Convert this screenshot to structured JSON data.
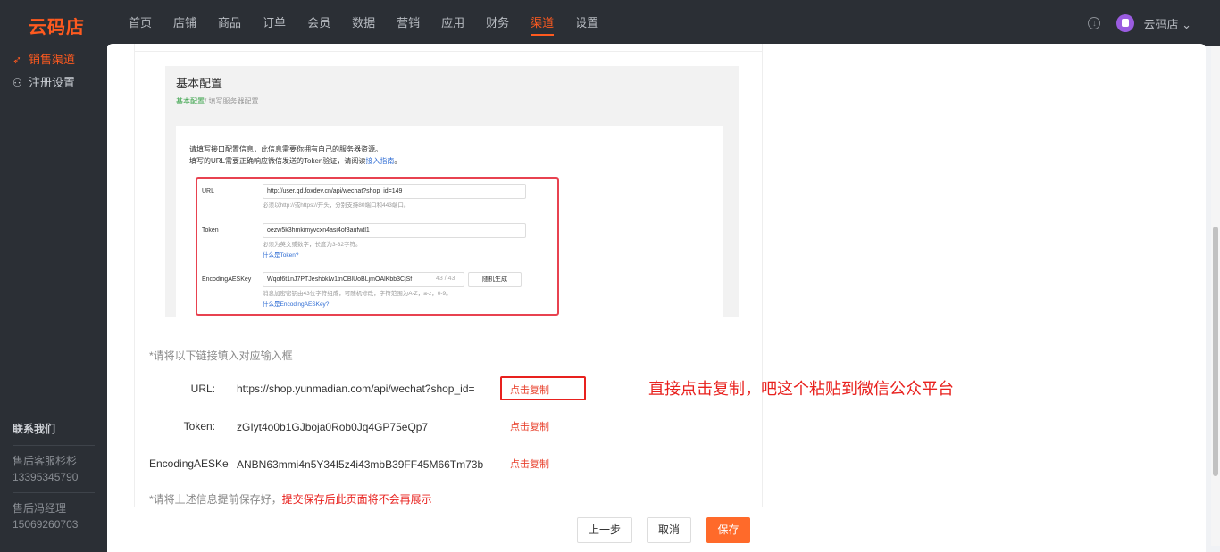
{
  "brand": {
    "logo": "云码店",
    "accent": "#ff5a1f"
  },
  "nav": {
    "items": [
      "首页",
      "店铺",
      "商品",
      "订单",
      "会员",
      "数据",
      "营销",
      "应用",
      "财务",
      "渠道",
      "设置"
    ],
    "active": "渠道"
  },
  "topright": {
    "store_name": "云码店 ⌄",
    "download_icon": "download-icon"
  },
  "sidebar": {
    "items": [
      {
        "label": "销售渠道",
        "icon": "send-icon",
        "active": true
      },
      {
        "label": "注册设置",
        "icon": "user-settings-icon",
        "active": false
      }
    ],
    "contact_title": "联系我们",
    "contacts": [
      {
        "name": "售后客服杉杉",
        "phone": "13395345790"
      },
      {
        "name": "售后冯经理",
        "phone": "15069260703"
      }
    ]
  },
  "screenshot": {
    "title": "基本配置",
    "crumb_active": "基本配置",
    "crumb_rest": "/ 填写服务器配置",
    "desc_line1": "请填写接口配置信息，此信息需要你拥有自己的服务器资源。",
    "desc_line2": "填写的URL需要正确响应微信发送的Token验证，请阅读",
    "desc_link": "接入指南",
    "desc_end": "。",
    "url_label": "URL",
    "url_value": "http://user.qd.foxdev.cn/api/wechat?shop_id=149",
    "url_hint": "必须以http://或https://开头，分别支持80端口和443端口。",
    "token_label": "Token",
    "token_value": "oezw5k3hmkimyvcxn4asi4of3aufwtl1",
    "token_hint": "必须为英文或数字，长度为3-32字符。",
    "token_link": "什么是Token?",
    "aes_label": "EncodingAESKey",
    "aes_value": "Wqof6t1nJ7PTJeshbklw1tnCBlUoBLjmOAlKbb3CjSf",
    "aes_count": "43 / 43",
    "aes_button": "随机生成",
    "aes_hint": "消息加密密钥由43位字符组成，可随机修改，字符范围为A-Z，a-z，0-9。",
    "aes_link": "什么是EncodingAESKey?"
  },
  "instructions": {
    "fill_note": "*请将以下链接填入对应输入框"
  },
  "fields": {
    "url": {
      "label": "URL:",
      "value": "https://shop.yunmadian.com/api/wechat?shop_id=",
      "copy": "点击复制"
    },
    "token": {
      "label": "Token:",
      "value": "zGIyt4o0b1GJboja0Rob0Jq4GP75eQp7",
      "copy": "点击复制"
    },
    "aes": {
      "label": "EncodingAESKe",
      "value": "ANBN63mmi4n5Y34I5z4i43mbB39FF45M66Tm73b",
      "copy": "点击复制"
    }
  },
  "save_note": {
    "prefix": "*请将上述信息提前保存好，",
    "warning": "提交保存后此页面将不会再展示"
  },
  "annotation": "直接点击复制，吧这个粘贴到微信公众平台",
  "footer": {
    "prev": "上一步",
    "cancel": "取消",
    "save": "保存"
  }
}
